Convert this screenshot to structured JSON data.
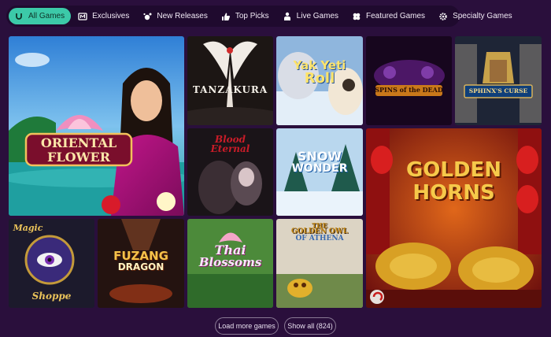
{
  "tabs": [
    {
      "label": "All Games",
      "icon": "horseshoe-icon",
      "active": true
    },
    {
      "label": "Exclusives",
      "icon": "exclusive-badge-icon"
    },
    {
      "label": "New Releases",
      "icon": "sparkle-icon"
    },
    {
      "label": "Top Picks",
      "icon": "thumbs-up-icon"
    },
    {
      "label": "Live Games",
      "icon": "dealer-icon"
    },
    {
      "label": "Featured Games",
      "icon": "clover-icon"
    },
    {
      "label": "Specialty Games",
      "icon": "gear-icon"
    }
  ],
  "games": [
    {
      "title_line1": "ORIENTAL",
      "title_line2": "FLOWER"
    },
    {
      "title": "TANZAKURA"
    },
    {
      "title_line1": "Yak",
      "title_line2": "Yeti",
      "title_line3": "Roll"
    },
    {
      "title": "SPINS of the DEAD"
    },
    {
      "title": "SPHINX'S CURSE"
    },
    {
      "title_line1": "Blood",
      "title_line2": "Eternal"
    },
    {
      "title_line1": "SNOW",
      "title_line2": "WONDER"
    },
    {
      "title_line1": "GOLDEN",
      "title_line2": "HORNS"
    },
    {
      "title_line1": "Magic",
      "title_line2": "Shoppe"
    },
    {
      "title_line1": "FUZANG",
      "title_line2": "DRAGON"
    },
    {
      "title_line1": "Thai",
      "title_line2": "Blossoms"
    },
    {
      "title_line1": "THE",
      "title_line2": "GOLDEN OWL",
      "title_line3": "OF ATHENA"
    }
  ],
  "buttons": {
    "load_more": "Load more games",
    "show_all": "Show all (824)"
  }
}
